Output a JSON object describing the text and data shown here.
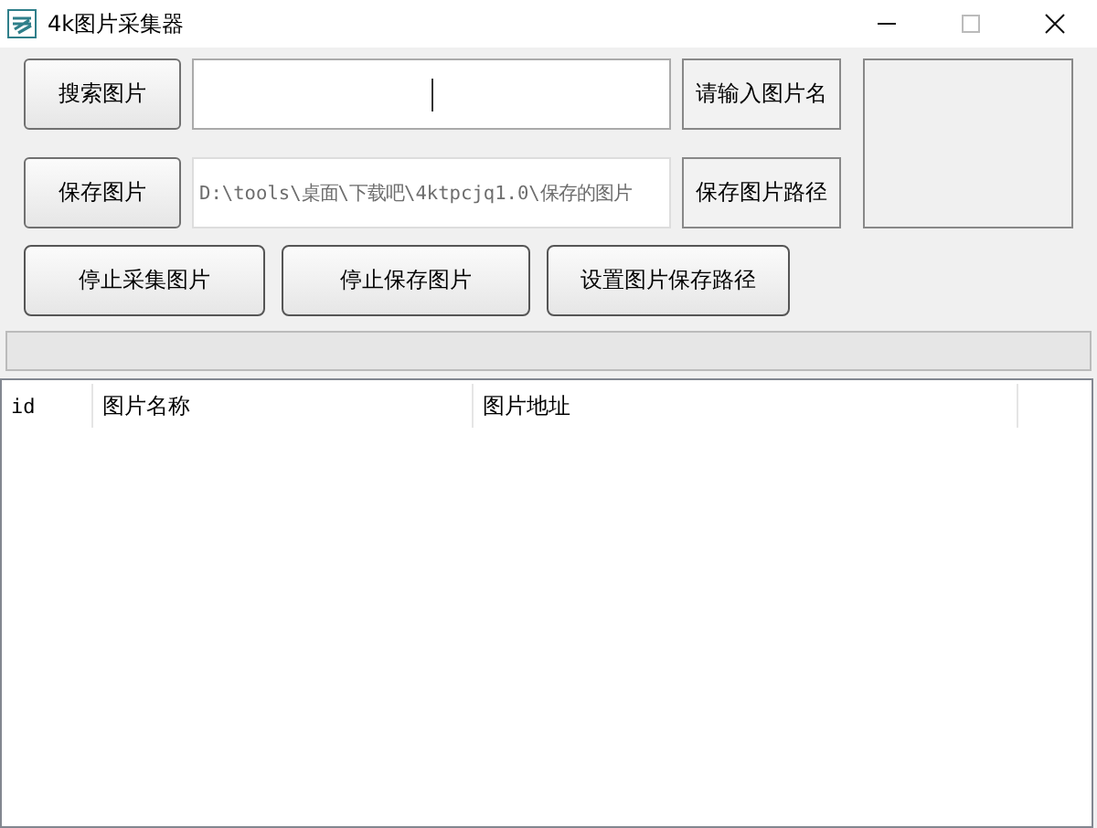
{
  "window": {
    "title": "4k图片采集器"
  },
  "row1": {
    "button": "搜索图片",
    "search": {
      "focused": true
    },
    "hint_button": "请输入图片名"
  },
  "row2": {
    "button": "保存图片",
    "path": {
      "value": "D:\\tools\\桌面\\下载吧\\4ktpcjq1.0\\保存的图片",
      "disabled": true
    },
    "path_button": "保存图片路径"
  },
  "buttons": [
    "停止采集图片",
    "停止保存图片",
    "设置图片保存路径"
  ],
  "progress": {
    "level": 0
  },
  "table": {
    "columns": [
      "id",
      "图片名称",
      "图片地址"
    ]
  }
}
